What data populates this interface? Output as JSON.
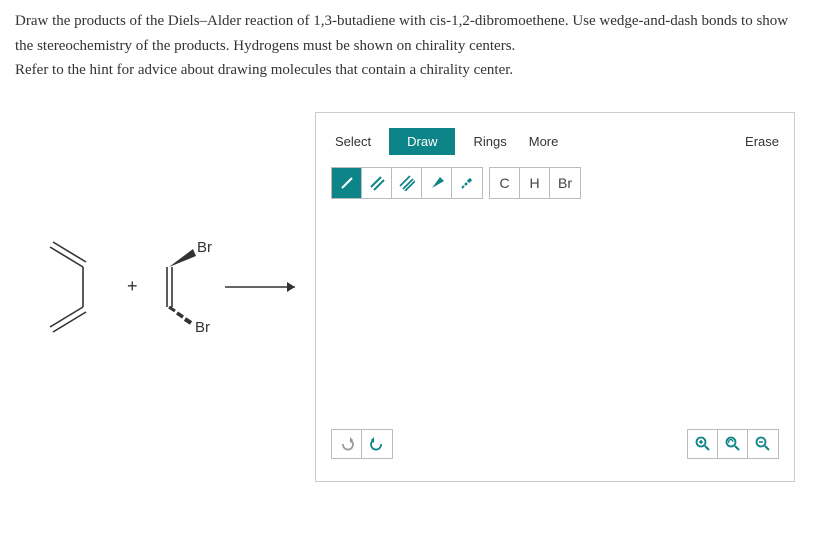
{
  "question": {
    "line1": "Draw the products of the Diels–Alder reaction of 1,3-butadiene with cis-1,2-dibromoethene. Use wedge-and-dash bonds to show",
    "line2": "the stereochemistry of the products. Hydrogens must be shown on chirality centers.",
    "line3": "Refer to the hint for advice about drawing molecules that contain a chirality center."
  },
  "reaction": {
    "plus": "+",
    "label_top": "Br",
    "label_bottom": "Br"
  },
  "toolbar": {
    "select": "Select",
    "draw": "Draw",
    "rings": "Rings",
    "more": "More",
    "erase": "Erase"
  },
  "elements": {
    "c": "C",
    "h": "H",
    "br": "Br"
  }
}
